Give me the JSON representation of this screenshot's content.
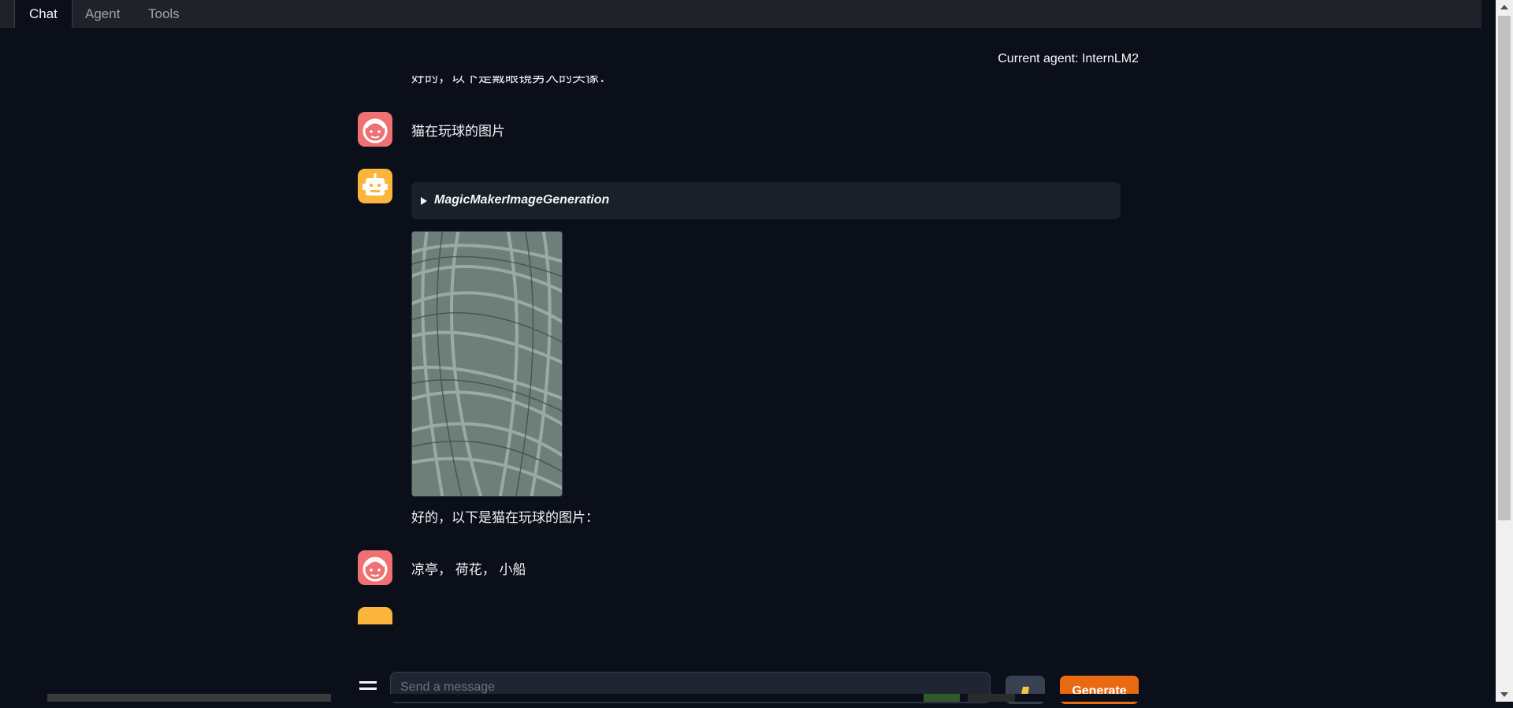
{
  "tabs": [
    {
      "label": "Chat",
      "active": true
    },
    {
      "label": "Agent",
      "active": false
    },
    {
      "label": "Tools",
      "active": false
    }
  ],
  "header": {
    "current_agent": "Current agent: InternLM2"
  },
  "messages": [
    {
      "role": "assistant",
      "text": "好的，以下是戴眼镜男人的头像："
    },
    {
      "role": "user",
      "text": "猫在玩球的图片"
    },
    {
      "role": "assistant",
      "tool_name": "MagicMakerImageGeneration",
      "text": "好的，以下是猫在玩球的图片："
    },
    {
      "role": "user",
      "text": "凉亭， 荷花， 小船"
    }
  ],
  "input": {
    "placeholder": "Send a message",
    "value": ""
  },
  "buttons": {
    "generate": "Generate"
  },
  "colors": {
    "background": "#0b0f19",
    "user_avatar": "#f07174",
    "bot_avatar": "#fbb53c",
    "generate_button": "#ea6a12",
    "tool_box": "#1a2029"
  },
  "icons": [
    "user-avatar-icon",
    "robot-avatar-icon",
    "expand-triangle-icon",
    "menu-icon",
    "upload-icon"
  ]
}
